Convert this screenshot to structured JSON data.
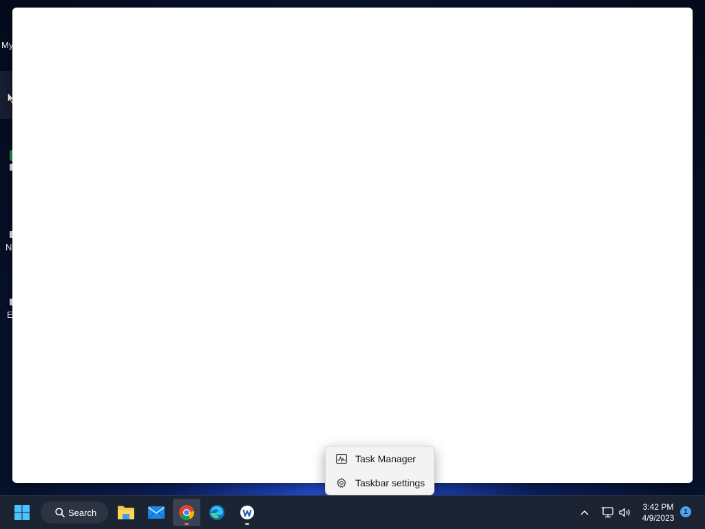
{
  "desktop": {
    "fragments": [
      "My",
      "N",
      "E"
    ],
    "wallpaper_accent": "#2f6bff"
  },
  "window": {
    "background": "#ffffff"
  },
  "context_menu": {
    "items": [
      {
        "label": "Task Manager",
        "icon": "task-manager-icon"
      },
      {
        "label": "Taskbar settings",
        "icon": "gear-icon"
      }
    ]
  },
  "taskbar": {
    "search_label": "Search",
    "apps": [
      {
        "name": "File Explorer",
        "icon": "file-explorer-icon"
      },
      {
        "name": "Mail",
        "icon": "mail-icon"
      },
      {
        "name": "Google Chrome",
        "icon": "chrome-icon",
        "active": true
      },
      {
        "name": "Microsoft Edge",
        "icon": "edge-icon"
      },
      {
        "name": "App",
        "icon": "app-icon",
        "running": true
      }
    ],
    "tray": {
      "chevron": "chevron-up-icon",
      "network": "network-icon",
      "volume": "volume-icon"
    },
    "clock": {
      "time": "3:42 PM",
      "date": "4/9/2023"
    },
    "notification_count": "1"
  }
}
